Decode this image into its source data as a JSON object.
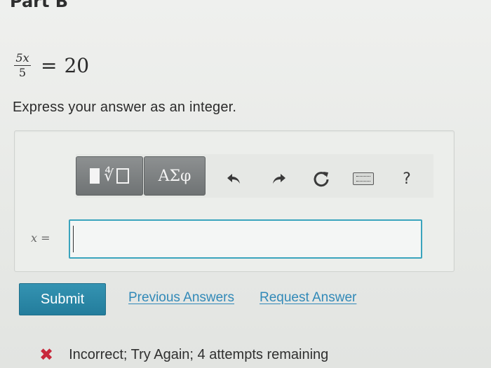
{
  "part": {
    "title": "Part B"
  },
  "equation": {
    "numerator": "5x",
    "denominator": "5",
    "equals": "=",
    "rhs": "20"
  },
  "instruction": "Express your answer as an integer.",
  "toolbar": {
    "greek_label": "ΑΣφ",
    "undo_icon": "undo-icon",
    "redo_icon": "redo-icon",
    "reset_icon": "reset-icon",
    "keyboard_icon": "keyboard-icon",
    "help_label": "?"
  },
  "answer": {
    "variable": "x",
    "equals": "=",
    "value": ""
  },
  "actions": {
    "submit_label": "Submit",
    "previous_answers_label": "Previous Answers",
    "request_answer_label": "Request Answer"
  },
  "feedback": {
    "icon": "✖",
    "text": "Incorrect; Try Again; 4 attempts remaining",
    "color": "#c8283b"
  },
  "colors": {
    "accent": "#2a87a8",
    "link": "#3189b8",
    "input_border": "#3aa4bd"
  }
}
